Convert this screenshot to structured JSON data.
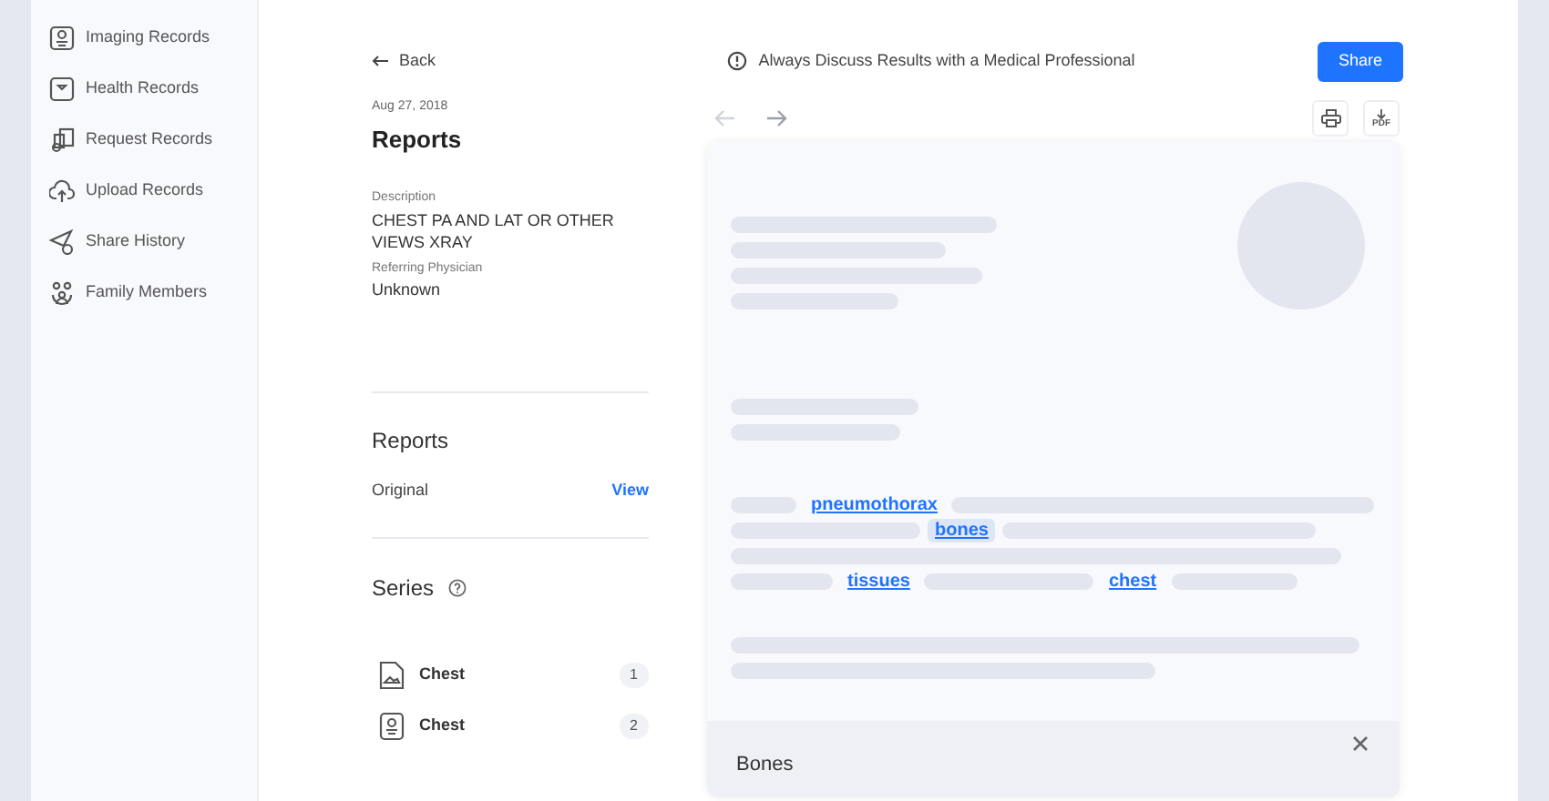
{
  "sidebar": {
    "items": [
      {
        "label": "Imaging Records"
      },
      {
        "label": "Health Records"
      },
      {
        "label": "Request Records"
      },
      {
        "label": "Upload Records"
      },
      {
        "label": "Share History"
      },
      {
        "label": "Family Members"
      }
    ]
  },
  "header": {
    "back": "Back",
    "notice": "Always Discuss Results with a Medical Professional",
    "share": "Share"
  },
  "study": {
    "date": "Aug 27, 2018",
    "title": "Reports",
    "fields": [
      {
        "label": "Description",
        "value": "CHEST PA AND LAT OR OTHER VIEWS XRAY"
      },
      {
        "label": "Referring Physician",
        "value": "Unknown"
      }
    ]
  },
  "reports": {
    "heading": "Reports",
    "items": [
      {
        "name": "Original",
        "action": "View"
      }
    ]
  },
  "series": {
    "heading": "Series",
    "items": [
      {
        "name": "Chest",
        "count": "1"
      },
      {
        "name": "Chest",
        "count": "2"
      }
    ]
  },
  "viewer": {
    "pdf_label": "PDF",
    "terms": [
      {
        "text": "pneumothorax",
        "selected": false
      },
      {
        "text": "bones",
        "selected": true
      },
      {
        "text": "tissues",
        "selected": false
      },
      {
        "text": "chest",
        "selected": false
      }
    ],
    "popup": {
      "title": "Bones"
    }
  }
}
